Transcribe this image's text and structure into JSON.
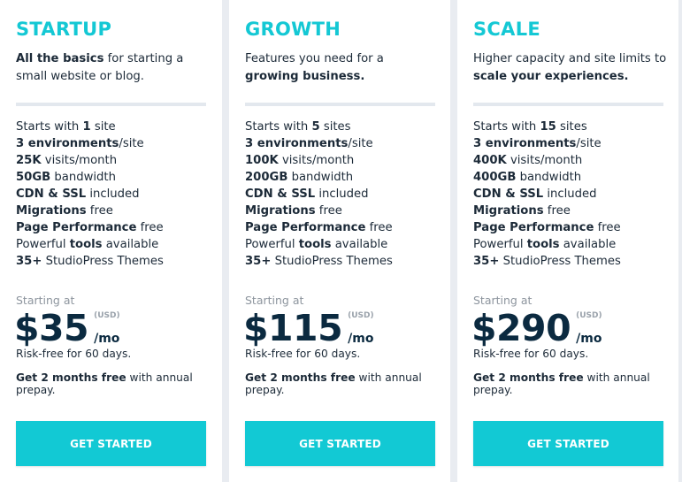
{
  "plans": [
    {
      "name": "STARTUP",
      "desc_bold": "All the basics",
      "desc_rest": " for starting a small website or blog.",
      "features": [
        {
          "pre": "Starts with ",
          "bold": "1",
          "post": " site"
        },
        {
          "pre": "",
          "bold": "3 environments",
          "post": "/site"
        },
        {
          "pre": "",
          "bold": "25K",
          "post": " visits/month"
        },
        {
          "pre": "",
          "bold": "50GB",
          "post": " bandwidth"
        },
        {
          "pre": "",
          "bold": "CDN & SSL",
          "post": " included"
        },
        {
          "pre": "",
          "bold": "Migrations",
          "post": " free"
        },
        {
          "pre": "",
          "bold": "Page Performance",
          "post": " free"
        },
        {
          "pre": "Powerful ",
          "bold": "tools",
          "post": " available"
        },
        {
          "pre": "",
          "bold": "35+",
          "post": " StudioPress Themes"
        }
      ],
      "starting_at": "Starting at",
      "price": "$35",
      "currency": "(USD)",
      "period": "/mo",
      "risk_free": "Risk-free for 60 days.",
      "annual_bold": "Get 2 months free",
      "annual_rest": " with annual prepay.",
      "cta": "GET STARTED"
    },
    {
      "name": "GROWTH",
      "desc_pre": "Features you need for a ",
      "desc_bold": "growing business.",
      "features": [
        {
          "pre": "Starts with ",
          "bold": "5",
          "post": " sites"
        },
        {
          "pre": "",
          "bold": "3 environments",
          "post": "/site"
        },
        {
          "pre": "",
          "bold": "100K",
          "post": " visits/month"
        },
        {
          "pre": "",
          "bold": "200GB",
          "post": " bandwidth"
        },
        {
          "pre": "",
          "bold": "CDN & SSL",
          "post": " included"
        },
        {
          "pre": "",
          "bold": "Migrations",
          "post": " free"
        },
        {
          "pre": "",
          "bold": "Page Performance",
          "post": " free"
        },
        {
          "pre": "Powerful ",
          "bold": "tools",
          "post": " available"
        },
        {
          "pre": "",
          "bold": "35+",
          "post": " StudioPress Themes"
        }
      ],
      "starting_at": "Starting at",
      "price": "$115",
      "currency": "(USD)",
      "period": "/mo",
      "risk_free": "Risk-free for 60 days.",
      "annual_bold": "Get 2 months free",
      "annual_rest": " with annual prepay.",
      "cta": "GET STARTED"
    },
    {
      "name": "SCALE",
      "desc_pre": "Higher capacity and site limits to ",
      "desc_bold": "scale your experiences.",
      "features": [
        {
          "pre": "Starts with ",
          "bold": "15",
          "post": " sites"
        },
        {
          "pre": "",
          "bold": "3 environments",
          "post": "/site"
        },
        {
          "pre": "",
          "bold": "400K",
          "post": " visits/month"
        },
        {
          "pre": "",
          "bold": "400GB",
          "post": " bandwidth"
        },
        {
          "pre": "",
          "bold": "CDN & SSL",
          "post": " included"
        },
        {
          "pre": "",
          "bold": "Migrations",
          "post": " free"
        },
        {
          "pre": "",
          "bold": "Page Performance",
          "post": " free"
        },
        {
          "pre": "Powerful ",
          "bold": "tools",
          "post": " available"
        },
        {
          "pre": "",
          "bold": "35+",
          "post": " StudioPress Themes"
        }
      ],
      "starting_at": "Starting at",
      "price": "$290",
      "currency": "(USD)",
      "period": "/mo",
      "risk_free": "Risk-free for 60 days.",
      "annual_bold": "Get 2 months free",
      "annual_rest": " with annual prepay.",
      "cta": "GET STARTED"
    }
  ],
  "colors": {
    "accent": "#12c9d4",
    "title": "#14c8d4",
    "text": "#1c2a38",
    "price": "#0b2a40",
    "muted": "#8d959e",
    "background": "#e9ecf1",
    "divider": "#e3e8ee"
  }
}
